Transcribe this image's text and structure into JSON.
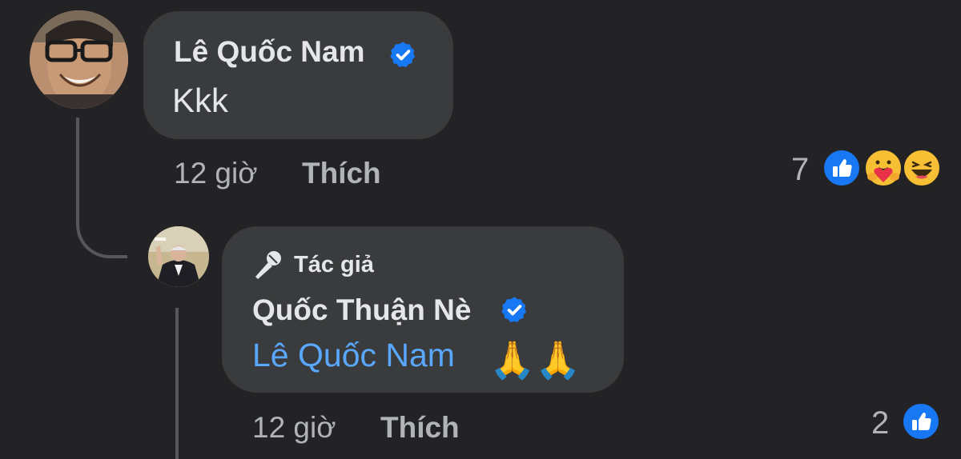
{
  "comment": {
    "author": "Lê Quốc Nam",
    "text": "Kkk",
    "time": "12 giờ",
    "like_label": "Thích",
    "reaction_count": "7",
    "reactions": [
      "like-icon",
      "care-icon",
      "haha-icon"
    ]
  },
  "reply": {
    "author_badge_label": "Tác giả",
    "author": "Quốc Thuận Nè",
    "mention": "Lê Quốc Nam",
    "emoji": "🙏🙏",
    "time": "12 giờ",
    "like_label": "Thích",
    "reaction_count": "2",
    "reactions": [
      "like-icon"
    ]
  },
  "colors": {
    "background": "#232325",
    "bubble": "#3a3b3c",
    "verified_blue": "#1877f2",
    "mention_blue": "#5aa7ff",
    "meta_text": "#b0b3b8"
  }
}
